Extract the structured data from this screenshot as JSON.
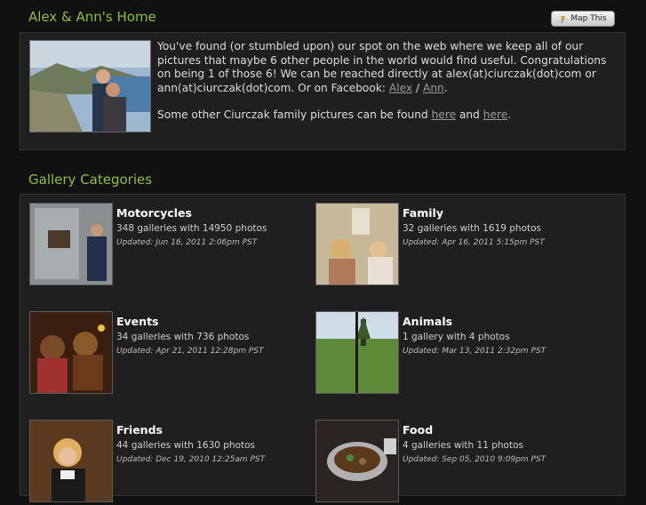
{
  "header": {
    "title": "Alex & Ann's Home",
    "map_button": "Map This",
    "map_icon": "pin-icon"
  },
  "intro": {
    "text_before_links": "You've found (or stumbled upon) our spot on the web where we keep all of our pictures that maybe 6 other people in the world would find useful. Congratulations on being 1 of those 6! We can be reached directly at alex(at)ciurczak(dot)com or ann(at)ciurczak(dot)com. Or on Facebook: ",
    "link_alex": "Alex",
    "separator": " / ",
    "link_ann": "Ann",
    "end_period": ".",
    "more_prefix": "Some other Ciurczak family pictures can be found ",
    "link_here1": "here",
    "more_and": " and ",
    "link_here2": "here",
    "more_end": "."
  },
  "gallery": {
    "title": "Gallery Categories",
    "categories": [
      {
        "name": "Motorcycles",
        "count": "348 galleries with 14950 photos",
        "updated": "Updated: Jun 16, 2011 2:06pm PST"
      },
      {
        "name": "Family",
        "count": "32 galleries with 1619 photos",
        "updated": "Updated: Apr 16, 2011 5:15pm PST"
      },
      {
        "name": "Events",
        "count": "34 galleries with 736 photos",
        "updated": "Updated: Apr 21, 2011 12:28pm PST"
      },
      {
        "name": "Animals",
        "count": "1 gallery with 4 photos",
        "updated": "Updated: Mar 13, 2011 2:32pm PST"
      },
      {
        "name": "Friends",
        "count": "44 galleries with 1630 photos",
        "updated": "Updated: Dec 19, 2010 12:25am PST"
      },
      {
        "name": "Food",
        "count": "4 galleries with 11 photos",
        "updated": "Updated: Sep 05, 2010 9:09pm PST"
      }
    ]
  },
  "colors": {
    "accent": "#8fbf3a",
    "background": "#111111",
    "panel": "#1f1f1f"
  }
}
